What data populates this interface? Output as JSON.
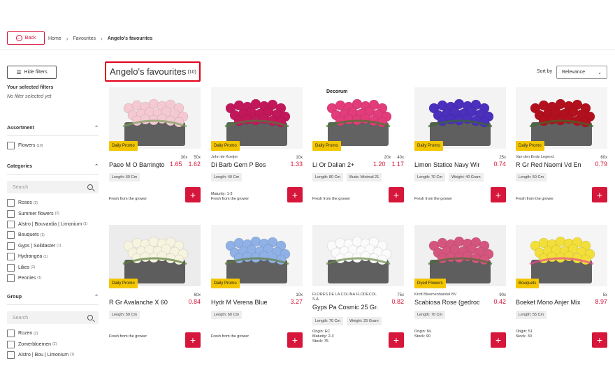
{
  "back": {
    "label": "Back"
  },
  "breadcrumb": [
    "Home",
    "Favourites",
    "Angelo's favourites"
  ],
  "sidebar": {
    "hide_filters": "Hide filters",
    "selected_title": "Your selected filters",
    "selected_none": "No filter selected yet",
    "assortment": {
      "title": "Assortment",
      "items": [
        {
          "label": "Flowers",
          "count": "(10)"
        }
      ]
    },
    "categories": {
      "title": "Categories",
      "search_placeholder": "Search",
      "items": [
        {
          "label": "Roses",
          "count": "(2)"
        },
        {
          "label": "Summer flowers",
          "count": "(2)"
        },
        {
          "label": "Alstro | Bouvardia | Limonium",
          "count": "(1)"
        },
        {
          "label": "Bouquets",
          "count": "(1)"
        },
        {
          "label": "Gyps | Solidaster",
          "count": "(1)"
        },
        {
          "label": "Hydrangea",
          "count": "(1)"
        },
        {
          "label": "Lilies",
          "count": "(1)"
        },
        {
          "label": "Peonies",
          "count": "(1)"
        }
      ]
    },
    "group": {
      "title": "Group",
      "search_placeholder": "Search",
      "items": [
        {
          "label": "Rozen",
          "count": "(2)"
        },
        {
          "label": "Zomerbloemen",
          "count": "(2)"
        },
        {
          "label": "Alstro | Bou | Limonium",
          "count": "(1)"
        }
      ]
    }
  },
  "title": {
    "text": "Angelo's favourites",
    "count": "(10)"
  },
  "sort": {
    "label": "Sort by",
    "value": "Relevance"
  },
  "products": [
    {
      "name": "Paeo M O Barringto",
      "grower": "",
      "qtys": [
        "30x",
        "50x"
      ],
      "prices": [
        "1.65",
        "1.62"
      ],
      "badge": "Daily Promo",
      "tags": [
        "Length: 60 Cm"
      ],
      "meta": [
        "Fresh from the grower"
      ],
      "img_bg": "#f3f3f3",
      "flower": "#f4c9d2",
      "accent": "#7aa05b"
    },
    {
      "name": "Di Barb Gem P Bos",
      "grower": "John de Koeijer",
      "qtys": [
        "10x"
      ],
      "prices": [
        "1.33"
      ],
      "badge": "Daily Promo",
      "tags": [
        "Length: 40 Cm"
      ],
      "meta": [
        "Maturity: 1-3",
        "Fresh from the grower"
      ],
      "img_bg": "#f5f5f5",
      "flower": "#c2185b",
      "accent": "#4f7a3a"
    },
    {
      "name": "Li Or Dalian 2+",
      "grower": "",
      "qtys": [
        "20x",
        "40x"
      ],
      "prices": [
        "1.20",
        "1.17"
      ],
      "badge": "Daily Promo",
      "tags": [
        "Length: 80 Cm",
        "Buds: Minimal 21"
      ],
      "meta": [
        "Fresh from the grower"
      ],
      "img_bg": "#ffffff",
      "flower": "#e23c7b",
      "accent": "#3f7a2a",
      "brand": "Decorum"
    },
    {
      "name": "Limon Statice Navy Win...",
      "grower": "",
      "qtys": [
        "25x"
      ],
      "prices": [
        "0.74"
      ],
      "badge": "Daily Promo",
      "tags": [
        "Length: 70 Cm",
        "Weight: 40 Gram"
      ],
      "meta": [
        "Fresh from the grower"
      ],
      "img_bg": "#f3f3f3",
      "flower": "#4b2fbd",
      "accent": "#3b6b2a"
    },
    {
      "name": "R Gr Red Naomi Vd End...",
      "grower": "Van den Ende Legend",
      "qtys": [
        "60x"
      ],
      "prices": [
        "0.79"
      ],
      "badge": "Daily Promo",
      "tags": [
        "Length: 50 Cm"
      ],
      "meta": [
        "Fresh from the grower"
      ],
      "img_bg": "#f5f5f5",
      "flower": "#b3101e",
      "accent": "#3e6b2a"
    },
    {
      "name": "R Gr Avalanche X 60",
      "grower": "",
      "qtys": [
        "60x"
      ],
      "prices": [
        "0.84"
      ],
      "badge": "Daily Promo",
      "tags": [
        "Length: 50 Cm"
      ],
      "meta": [
        "Fresh from the grower"
      ],
      "img_bg": "#ececec",
      "flower": "#f6f4df",
      "accent": "#5a7a3a"
    },
    {
      "name": "Hydr M Verena Blue",
      "grower": "",
      "qtys": [
        "10x"
      ],
      "prices": [
        "3.27"
      ],
      "badge": "Daily Promo",
      "tags": [
        "Length: 60 Cm"
      ],
      "meta": [
        "Fresh from the grower"
      ],
      "img_bg": "#f5f5f5",
      "flower": "#8fb1e6",
      "accent": "#5d7a3d"
    },
    {
      "name": "Gyps Pa Cosmic 25 Gra...",
      "grower": "FLORES DE LA COLINA FLODECOL S.A.",
      "qtys": [
        "75x"
      ],
      "prices": [
        "0.82"
      ],
      "badge": "",
      "tags": [
        "Length: 70 Cm",
        "Weight: 25 Gram"
      ],
      "meta": [
        "Origin: EC",
        "Maturity: 2-3",
        "Stock: 75"
      ],
      "img_bg": "#f2f2f2",
      "flower": "#fbfbfb",
      "accent": "#6b8a4a"
    },
    {
      "name": "Scabiosa Rose (gedroo...",
      "grower": "Kroft Bloemenhandel BV",
      "qtys": [
        "90x"
      ],
      "prices": [
        "0.42"
      ],
      "badge": "Dyed Flowers",
      "tags": [
        "Length: 70 Cm"
      ],
      "meta": [
        "Origin: NL",
        "Stock: 90"
      ],
      "img_bg": "#f0f0f0",
      "flower": "#d4567f",
      "accent": "#4a6b35"
    },
    {
      "name": "Boeket Mono Anjer Mix",
      "grower": "",
      "qtys": [
        "5x"
      ],
      "prices": [
        "8.97"
      ],
      "badge": "Bouquets",
      "tags": [
        "Length: 55 Cm"
      ],
      "meta": [
        "Origin: 51",
        "Stock: 30"
      ],
      "img_bg": "#f5f5f5",
      "flower": "#f2df3a",
      "accent": "#e84a8a"
    }
  ],
  "add_label": "+",
  "colors": {
    "brand": "#d6163a",
    "badge": "#f3c600"
  },
  "icons": {
    "back": "back-arrow-icon",
    "filters": "sliders-icon",
    "search": "search-icon",
    "caret": "chevron-up-icon",
    "sort": "chevron-down-icon",
    "add": "plus-icon"
  }
}
